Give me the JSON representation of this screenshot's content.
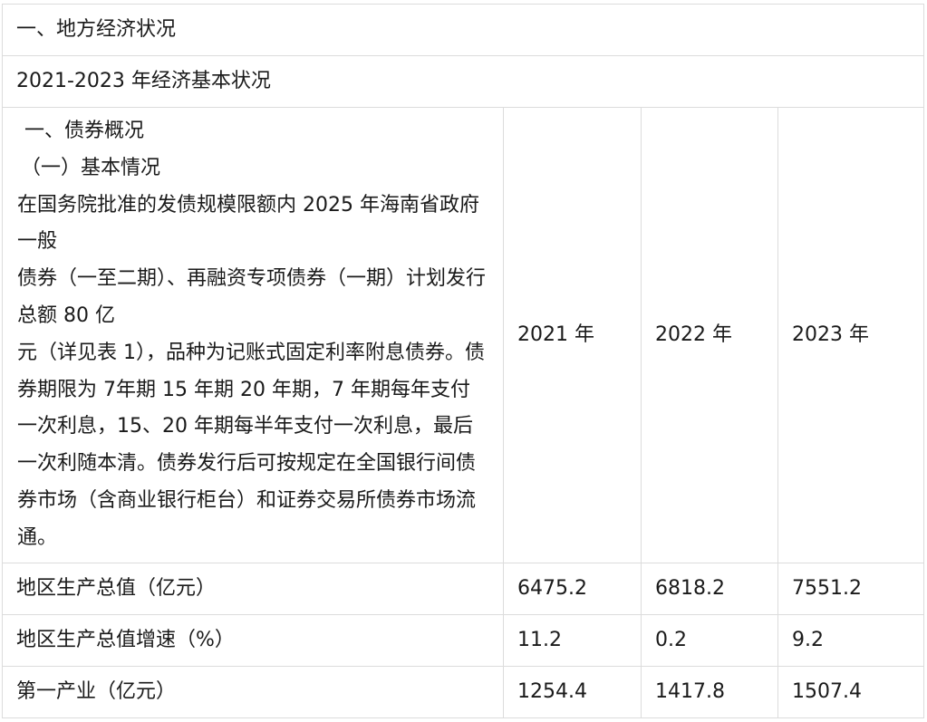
{
  "section_title": "一、地方经济状况",
  "subtitle": "2021-2023 年经济基本状况",
  "description": {
    "heading": "一、债券概况",
    "subheading": "（一）基本情况",
    "lines": [
      "在国务院批准的发债规模限额内  2025 年海南省政府一般",
      "债券（一至二期）、再融资专项债券（一期）计划发行总额 80 亿",
      "元（详见表 1），品种为记账式固定利率附息债券。债券期限为 7年期  15 年期  20 年期，7 年期每年支付一次利息，15、20 年期每半年支付一次利息，最后一次利随本清。债券发行后可按规定在全国银行间债券市场（含商业银行柜台）和证券交易所债券市场流通。"
    ]
  },
  "years": [
    "2021 年",
    "2022 年",
    "2023 年"
  ],
  "rows": [
    {
      "label": "地区生产总值（亿元）",
      "values": [
        "6475.2",
        "6818.2",
        "7551.2"
      ]
    },
    {
      "label": "地区生产总值增速（%）",
      "values": [
        "11.2",
        "0.2",
        "9.2"
      ]
    },
    {
      "label": "第一产业（亿元）",
      "values": [
        "1254.4",
        "1417.8",
        "1507.4"
      ]
    }
  ]
}
